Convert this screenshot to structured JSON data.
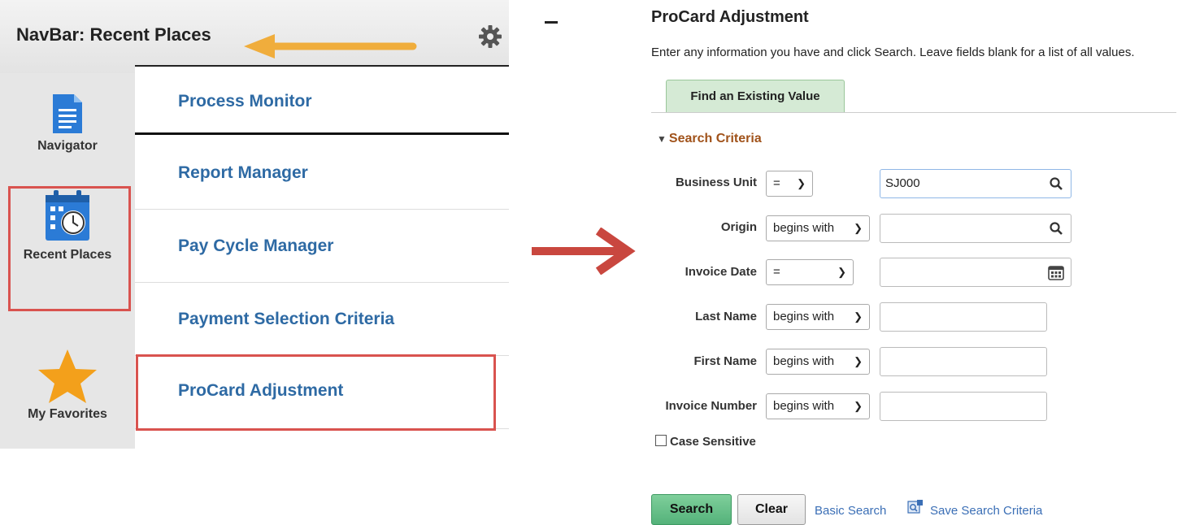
{
  "navbar": {
    "title": "NavBar: Recent Places",
    "left_items": [
      {
        "label": "Navigator",
        "icon": "document-icon"
      },
      {
        "label": "Recent Places",
        "icon": "calendar-clock-icon"
      },
      {
        "label": "My Favorites",
        "icon": "star-icon"
      }
    ],
    "list_items": [
      "Process Monitor",
      "Report Manager",
      "Pay Cycle Manager",
      "Payment Selection Criteria",
      "ProCard Adjustment"
    ]
  },
  "page": {
    "title": "ProCard Adjustment",
    "instructions": "Enter any information you have and click Search. Leave fields blank for a list of all values.",
    "tab": "Find an Existing Value",
    "section": "Search Criteria",
    "fields": [
      {
        "label": "Business Unit",
        "operator": "=",
        "value": ""
      },
      {
        "label": "Origin",
        "operator": "begins with",
        "value": ""
      },
      {
        "label": "Invoice Date",
        "operator": "=",
        "value": ""
      },
      {
        "label": "Last Name",
        "operator": "begins with",
        "value": ""
      },
      {
        "label": "First Name",
        "operator": "begins with",
        "value": ""
      },
      {
        "label": "Invoice Number",
        "operator": "begins with",
        "value": ""
      }
    ],
    "business_unit_value": "SJ000",
    "case_sensitive_label": "Case Sensitive",
    "buttons": {
      "search": "Search",
      "clear": "Clear"
    },
    "links": {
      "basic_search": "Basic Search",
      "save_search": "Save Search Criteria"
    }
  },
  "colors": {
    "link": "#2e6aa4",
    "highlight": "#d9534f",
    "accent_arrow": "#f0ad3c",
    "section": "#a0521a"
  }
}
